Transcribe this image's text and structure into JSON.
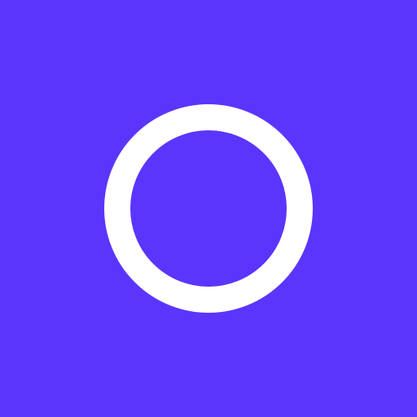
{
  "colors": {
    "background": "#5b35fc",
    "ring": "#ffffff"
  },
  "icon": "ring-icon"
}
